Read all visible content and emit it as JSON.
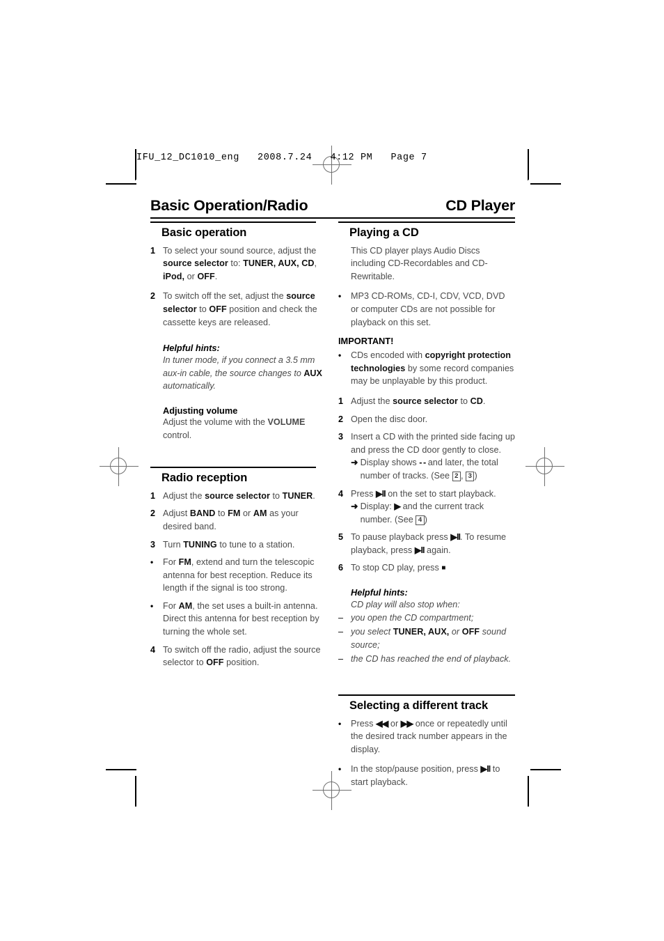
{
  "file_header": "IFU_12_DC1010_eng   2008.7.24   4:12 PM   Page 7",
  "header": {
    "left_title": "Basic Operation/Radio",
    "right_title": "CD Player"
  },
  "left_column": {
    "section1": {
      "title": "Basic operation",
      "steps": [
        {
          "marker": "1",
          "html": "To select your sound source, adjust the <b>source selector</b> to: <b>TUNER, AUX, CD</b>, <b>iPod,</b> or <b>OFF</b>."
        },
        {
          "marker": "2",
          "html": "To switch off the set, adjust the <b>source selector</b> to <b>OFF</b> position and check the cassette keys are released."
        }
      ],
      "hint_title": "Helpful hints:",
      "hint_html": "In tuner mode, if you connect a 3.5 mm aux-in cable, the source changes to <b>AUX</b> automatically.",
      "sub_title": "Adjusting volume",
      "sub_body_html": "Adjust the volume with the <b>VOLUME</b> control."
    },
    "section2": {
      "title": "Radio reception",
      "steps": [
        {
          "marker": "1",
          "html": "Adjust the <b>source selector</b> to <b>TUNER</b>."
        },
        {
          "marker": "2",
          "html": "Adjust <b>BAND</b> to <b>FM</b> or <b>AM</b> as your desired band."
        },
        {
          "marker": "3",
          "html": "Turn <b>TUNING</b> to tune to a station."
        },
        {
          "marker": "•",
          "html": "For <b>FM</b>, extend and turn the telescopic antenna for best reception. Reduce its length if the signal is too strong."
        },
        {
          "marker": "•",
          "html": "For <b>AM</b>, the set uses a built-in antenna. Direct this antenna for best reception by turning the whole set."
        },
        {
          "marker": "4",
          "html": "To switch off the radio, adjust the source selector to <b>OFF</b> position."
        }
      ]
    }
  },
  "right_column": {
    "section1": {
      "title": "Playing a CD",
      "intro_html": "This CD player plays Audio Discs including CD-Recordables and CD-Rewritable.",
      "bullet_html": "MP3 CD-ROMs, CD-I, CDV, VCD, DVD or computer CDs are not possible for playback on this set.",
      "important_label": "IMPORTANT!",
      "important_html": "CDs encoded with <b>copyright protection technologies</b> by some record companies may be unplayable by this product.",
      "steps": [
        {
          "marker": "1",
          "html": "Adjust the <b>source selector</b> to <b>CD</b>."
        },
        {
          "marker": "2",
          "html": "Open the disc door."
        },
        {
          "marker": "3",
          "html": "Insert a CD with the printed side facing up and press the CD door gently to close.",
          "sub_html": "Display shows <span class=\"sym\">- -</span> and later, the total number of tracks. (See <span class=\"numbox\">2</span>, <span class=\"numbox\">3</span>)"
        },
        {
          "marker": "4",
          "html": "Press <span class=\"sym\">&#9654;II</span> on the set to start playback.",
          "sub_html": "Display: <span class=\"sym\">&#9654;</span> and the current track number. (See <span class=\"numbox\">4</span>)"
        },
        {
          "marker": "5",
          "html": "To pause playback press <span class=\"sym\">&#9654;II</span>. To resume playback, press <span class=\"sym\">&#9654;II</span> again."
        },
        {
          "marker": "6",
          "html": "To stop CD play, press <span class=\"sym-sq\">&#9632;</span>"
        }
      ],
      "hint_title": "Helpful hints:",
      "hint_intro": "CD play will also stop when:",
      "hint_items": [
        {
          "marker": "–",
          "html": "you open the CD compartment;"
        },
        {
          "marker": "–",
          "html": "you select <b>TUNER, AUX,</b> or <b>OFF</b> sound source;"
        },
        {
          "marker": "–",
          "html": "the CD has reached the end of playback."
        }
      ]
    },
    "section2": {
      "title": "Selecting a different track",
      "bullets": [
        {
          "marker": "•",
          "html": "Press <span class=\"sym\">&#9664;&#9664;</span> or <span class=\"sym\">&#9654;&#9654;</span> once or repeatedly until the desired track number appears in the display."
        },
        {
          "marker": "•",
          "html": "In the stop/pause position, press <span class=\"sym\">&#9654;II</span> to start playback."
        }
      ]
    }
  }
}
